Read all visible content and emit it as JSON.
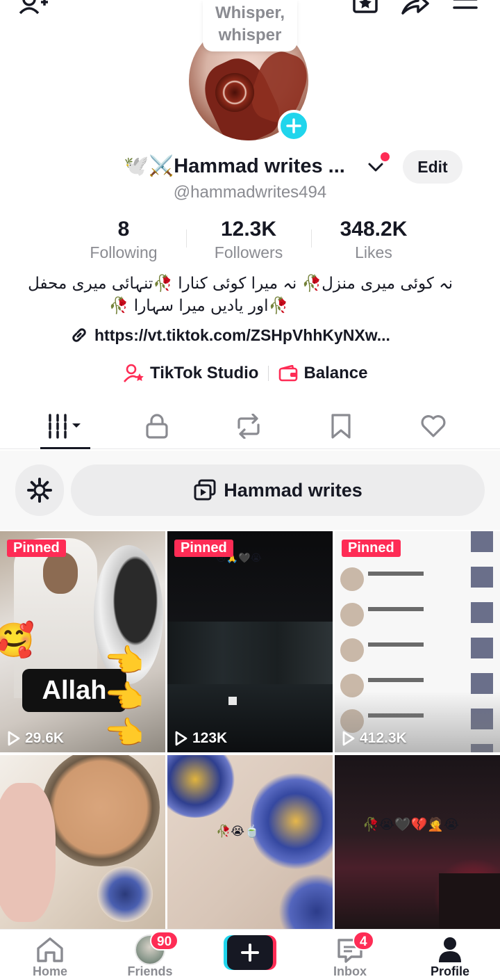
{
  "profile": {
    "avatar_bubble": "Whisper, whisper",
    "display_name": "🕊️⚔️Hammad writes ...",
    "handle": "@hammadwrites494",
    "edit_label": "Edit",
    "stats": [
      {
        "value": "8",
        "label": "Following"
      },
      {
        "value": "12.3K",
        "label": "Followers"
      },
      {
        "value": "348.2K",
        "label": "Likes"
      }
    ],
    "bio_line1": "نہ کوئی میری منزل🥀 نہ میرا کوئی کنارا 🥀تنہائی میری محفل",
    "bio_line2": "🥀اور یادیں میرا سہارا 🥀",
    "link": "https://vt.tiktok.com/ZSHpVhhKyNXw...",
    "studio_label": "TikTok Studio",
    "balance_label": "Balance"
  },
  "tabs": [
    "videos-icon",
    "lock-icon",
    "repost-icon",
    "bookmark-icon",
    "heart-icon"
  ],
  "filter": {
    "playlist_label": "Hammad writes"
  },
  "videos": [
    {
      "pinned": "Pinned",
      "views": "29.6K",
      "overlay": "Allah"
    },
    {
      "pinned": "Pinned",
      "views": "123K"
    },
    {
      "pinned": "Pinned",
      "views": "412.3K"
    },
    {
      "views": ""
    },
    {
      "views": "",
      "emoji": "🥀😭🍵"
    },
    {
      "views": "",
      "emoji": "🥀😭🖤💔🤦😭"
    }
  ],
  "bottom_nav": {
    "home": "Home",
    "friends": "Friends",
    "friends_badge": "90",
    "inbox": "Inbox",
    "inbox_badge": "4",
    "profile": "Profile"
  },
  "colors": {
    "accent": "#fe2c55",
    "cyan": "#20d5ec",
    "text": "#161823",
    "muted": "#8a8b91"
  }
}
